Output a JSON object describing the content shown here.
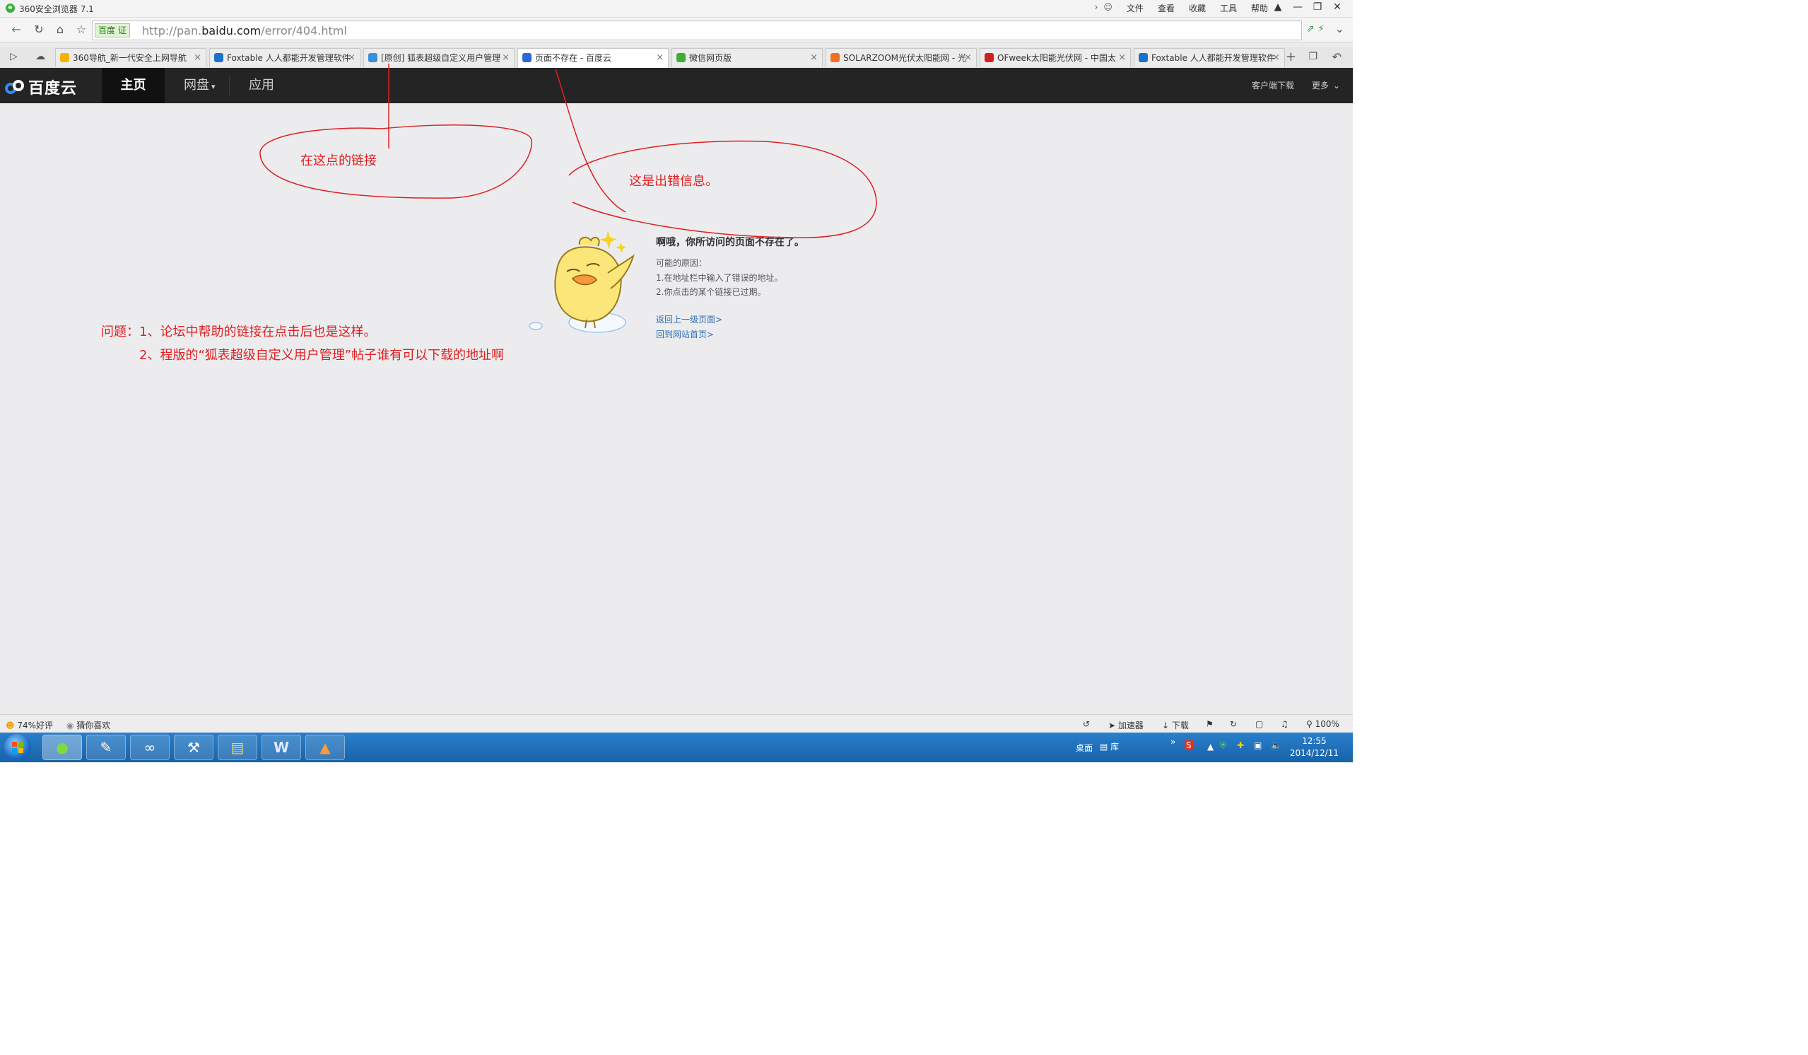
{
  "browser": {
    "title": "360安全浏览器 7.1",
    "menu": [
      "文件",
      "查看",
      "收藏",
      "工具",
      "帮助"
    ],
    "window_controls": [
      "—",
      "❐",
      "✕"
    ],
    "address": {
      "badge": "百度 证",
      "url_prefix": "http://pan.",
      "url_domain": "baidu.com",
      "url_path": "/error/404.html"
    },
    "tabs": [
      {
        "label": "360导航_新一代安全上网导航",
        "icon_color": "#f2b400",
        "active": false
      },
      {
        "label": "Foxtable 人人都能开发管理软件",
        "icon_color": "#1a73c8",
        "active": false
      },
      {
        "label": "[原创] 狐表超级自定义用户管理",
        "icon_color": "#3a8fd8",
        "active": false
      },
      {
        "label": "页面不存在 - 百度云",
        "icon_color": "#2a6ad6",
        "active": true
      },
      {
        "label": "微信网页版",
        "icon_color": "#3cb034",
        "active": false
      },
      {
        "label": "SOLARZOOM光伏太阳能网 - 光",
        "icon_color": "#f07020",
        "active": false
      },
      {
        "label": "OFweek太阳能光伏网 - 中国太",
        "icon_color": "#d02020",
        "active": false
      },
      {
        "label": "Foxtable 人人都能开发管理软件",
        "icon_color": "#1a73c8",
        "active": false
      }
    ]
  },
  "site": {
    "logo_text": "百度云",
    "nav_home": "主页",
    "nav_disk": "网盘",
    "nav_apps": "应用",
    "client_download": "客户端下载",
    "more": "更多"
  },
  "error": {
    "title": "啊哦，你所访问的页面不存在了。",
    "reasons_heading": "可能的原因：",
    "reason_1": "1.在地址栏中输入了错误的地址。",
    "reason_2": "2.你点击的某个链接已过期。",
    "link_back": "返回上一级页面>",
    "link_home": "回到网站首页>"
  },
  "annotations": {
    "link_note": "在这点的链接",
    "error_note": "这是出错信息。",
    "question_1": "问题：1、论坛中帮助的链接在点击后也是这样。",
    "question_2": "2、程版的“狐表超级自定义用户管理”帖子谁有可以下载的地址啊",
    "color": "#e02020"
  },
  "statusbar": {
    "rating": "74%好评",
    "guess": "猜你喜欢",
    "accelerator": "加速器",
    "download": "下载",
    "zoom": "100%"
  },
  "taskbar": {
    "desktop": "桌面",
    "library": "库",
    "time": "12:55",
    "date": "2014/12/11"
  }
}
